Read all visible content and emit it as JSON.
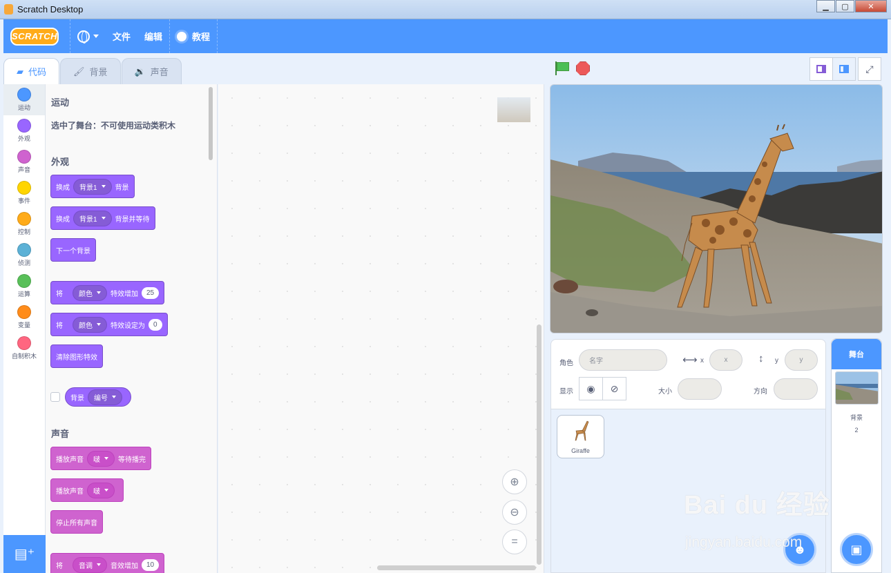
{
  "window": {
    "title": "Scratch Desktop"
  },
  "menubar": {
    "logo": "SCRATCH",
    "file": "文件",
    "edit": "编辑",
    "tutorials": "教程"
  },
  "tabs": {
    "code": "代码",
    "backdrops": "背景",
    "sounds": "声音"
  },
  "categories": [
    {
      "label": "运动",
      "color": "#4c97ff"
    },
    {
      "label": "外观",
      "color": "#9966ff"
    },
    {
      "label": "声音",
      "color": "#cf63cf"
    },
    {
      "label": "事件",
      "color": "#ffd500"
    },
    {
      "label": "控制",
      "color": "#ffab19"
    },
    {
      "label": "侦测",
      "color": "#5cb1d6"
    },
    {
      "label": "运算",
      "color": "#59c059"
    },
    {
      "label": "变量",
      "color": "#ff8c1a"
    },
    {
      "label": "自制积木",
      "color": "#ff6680"
    }
  ],
  "palette": {
    "motion_title": "运动",
    "motion_note": "选中了舞台：不可使用运动类积木",
    "looks_title": "外观",
    "switch_backdrop": {
      "prefix": "换成",
      "value": "背景1",
      "suffix": "背景"
    },
    "switch_backdrop_wait": {
      "prefix": "换成",
      "value": "背景1",
      "suffix": "背景并等待"
    },
    "next_backdrop": "下一个背景",
    "change_effect": {
      "prefix": "将",
      "effect": "颜色",
      "middle": "特效增加",
      "value": "25"
    },
    "set_effect": {
      "prefix": "将",
      "effect": "颜色",
      "middle": "特效设定为",
      "value": "0"
    },
    "clear_effects": "清除图形特效",
    "backdrop_reporter": {
      "label": "背景",
      "value": "编号"
    },
    "sound_title": "声音",
    "play_until_done": {
      "prefix": "播放声音",
      "value": "啵",
      "suffix": "等待播完"
    },
    "start_sound": {
      "prefix": "播放声音",
      "value": "啵"
    },
    "stop_all_sounds": "停止所有声音",
    "change_pitch": {
      "prefix": "将",
      "effect": "音调",
      "middle": "音效增加",
      "value": "10"
    }
  },
  "zoom": {
    "in_icon": "zoom-in-icon",
    "out_icon": "zoom-out-icon",
    "reset": "="
  },
  "sprite_info": {
    "sprite_label": "角色",
    "name_placeholder": "名字",
    "x_label": "x",
    "x_value": "x",
    "y_label": "y",
    "y_value": "y",
    "show_label": "显示",
    "size_label": "大小",
    "direction_label": "方向"
  },
  "sprites": [
    {
      "name": "Giraffe"
    }
  ],
  "stage_panel": {
    "title": "舞台",
    "backdrops_label": "背景",
    "backdrops_count": "2"
  },
  "watermark": {
    "main": "Bai du 经验",
    "sub": "jingyan.baidu.com"
  }
}
